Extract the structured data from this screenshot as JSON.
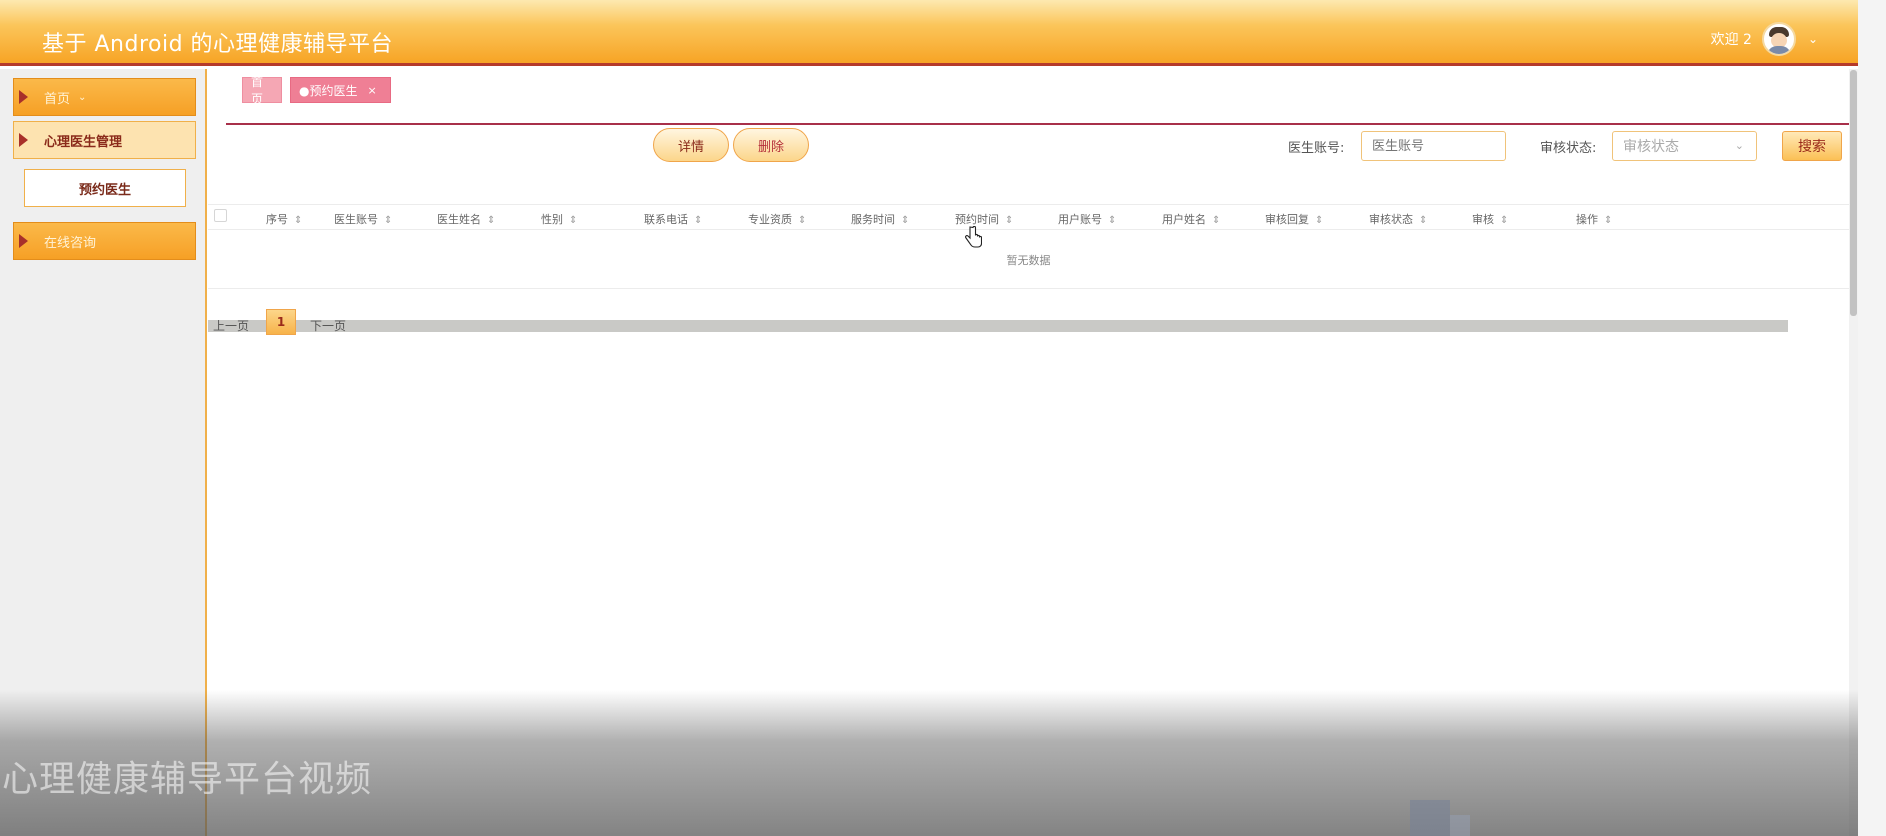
{
  "header": {
    "title": "基于 Android 的心理健康辅导平台",
    "welcome": "欢迎 2"
  },
  "sidebar": {
    "items": [
      {
        "label": "首页"
      },
      {
        "label": "心理医生管理"
      },
      {
        "label": "预约医生"
      },
      {
        "label": "在线咨询"
      }
    ]
  },
  "tabs": {
    "home": "首页",
    "current": "●预约医生",
    "close": "×"
  },
  "toolbar": {
    "detail_label": "详情",
    "delete_label": "删除"
  },
  "filters": {
    "doctor_account_label": "医生账号:",
    "doctor_account_placeholder": "医生账号",
    "status_label": "审核状态:",
    "status_placeholder": "审核状态",
    "search_label": "搜索"
  },
  "table": {
    "columns": [
      "序号",
      "医生账号",
      "医生姓名",
      "性别",
      "联系电话",
      "专业资质",
      "服务时间",
      "预约时间",
      "用户账号",
      "用户姓名",
      "审核回复",
      "审核状态",
      "审核",
      "操作"
    ],
    "empty_text": "暂无数据"
  },
  "pagination": {
    "prev": "上一页",
    "current": "1",
    "next": "下一页"
  },
  "overlay": {
    "caption": "心理健康辅导平台视频"
  },
  "colors": {
    "header_orange": "#f7a425",
    "accent_red": "#b53a2a",
    "tab_pink": "#ef7f95"
  }
}
